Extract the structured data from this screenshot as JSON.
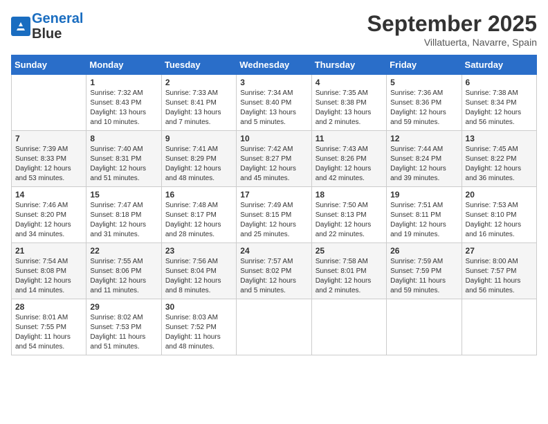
{
  "header": {
    "logo_line1": "General",
    "logo_line2": "Blue",
    "month": "September 2025",
    "location": "Villatuerta, Navarre, Spain"
  },
  "weekdays": [
    "Sunday",
    "Monday",
    "Tuesday",
    "Wednesday",
    "Thursday",
    "Friday",
    "Saturday"
  ],
  "weeks": [
    [
      {
        "day": "",
        "info": ""
      },
      {
        "day": "1",
        "info": "Sunrise: 7:32 AM\nSunset: 8:43 PM\nDaylight: 13 hours\nand 10 minutes."
      },
      {
        "day": "2",
        "info": "Sunrise: 7:33 AM\nSunset: 8:41 PM\nDaylight: 13 hours\nand 7 minutes."
      },
      {
        "day": "3",
        "info": "Sunrise: 7:34 AM\nSunset: 8:40 PM\nDaylight: 13 hours\nand 5 minutes."
      },
      {
        "day": "4",
        "info": "Sunrise: 7:35 AM\nSunset: 8:38 PM\nDaylight: 13 hours\nand 2 minutes."
      },
      {
        "day": "5",
        "info": "Sunrise: 7:36 AM\nSunset: 8:36 PM\nDaylight: 12 hours\nand 59 minutes."
      },
      {
        "day": "6",
        "info": "Sunrise: 7:38 AM\nSunset: 8:34 PM\nDaylight: 12 hours\nand 56 minutes."
      }
    ],
    [
      {
        "day": "7",
        "info": "Sunrise: 7:39 AM\nSunset: 8:33 PM\nDaylight: 12 hours\nand 53 minutes."
      },
      {
        "day": "8",
        "info": "Sunrise: 7:40 AM\nSunset: 8:31 PM\nDaylight: 12 hours\nand 51 minutes."
      },
      {
        "day": "9",
        "info": "Sunrise: 7:41 AM\nSunset: 8:29 PM\nDaylight: 12 hours\nand 48 minutes."
      },
      {
        "day": "10",
        "info": "Sunrise: 7:42 AM\nSunset: 8:27 PM\nDaylight: 12 hours\nand 45 minutes."
      },
      {
        "day": "11",
        "info": "Sunrise: 7:43 AM\nSunset: 8:26 PM\nDaylight: 12 hours\nand 42 minutes."
      },
      {
        "day": "12",
        "info": "Sunrise: 7:44 AM\nSunset: 8:24 PM\nDaylight: 12 hours\nand 39 minutes."
      },
      {
        "day": "13",
        "info": "Sunrise: 7:45 AM\nSunset: 8:22 PM\nDaylight: 12 hours\nand 36 minutes."
      }
    ],
    [
      {
        "day": "14",
        "info": "Sunrise: 7:46 AM\nSunset: 8:20 PM\nDaylight: 12 hours\nand 34 minutes."
      },
      {
        "day": "15",
        "info": "Sunrise: 7:47 AM\nSunset: 8:18 PM\nDaylight: 12 hours\nand 31 minutes."
      },
      {
        "day": "16",
        "info": "Sunrise: 7:48 AM\nSunset: 8:17 PM\nDaylight: 12 hours\nand 28 minutes."
      },
      {
        "day": "17",
        "info": "Sunrise: 7:49 AM\nSunset: 8:15 PM\nDaylight: 12 hours\nand 25 minutes."
      },
      {
        "day": "18",
        "info": "Sunrise: 7:50 AM\nSunset: 8:13 PM\nDaylight: 12 hours\nand 22 minutes."
      },
      {
        "day": "19",
        "info": "Sunrise: 7:51 AM\nSunset: 8:11 PM\nDaylight: 12 hours\nand 19 minutes."
      },
      {
        "day": "20",
        "info": "Sunrise: 7:53 AM\nSunset: 8:10 PM\nDaylight: 12 hours\nand 16 minutes."
      }
    ],
    [
      {
        "day": "21",
        "info": "Sunrise: 7:54 AM\nSunset: 8:08 PM\nDaylight: 12 hours\nand 14 minutes."
      },
      {
        "day": "22",
        "info": "Sunrise: 7:55 AM\nSunset: 8:06 PM\nDaylight: 12 hours\nand 11 minutes."
      },
      {
        "day": "23",
        "info": "Sunrise: 7:56 AM\nSunset: 8:04 PM\nDaylight: 12 hours\nand 8 minutes."
      },
      {
        "day": "24",
        "info": "Sunrise: 7:57 AM\nSunset: 8:02 PM\nDaylight: 12 hours\nand 5 minutes."
      },
      {
        "day": "25",
        "info": "Sunrise: 7:58 AM\nSunset: 8:01 PM\nDaylight: 12 hours\nand 2 minutes."
      },
      {
        "day": "26",
        "info": "Sunrise: 7:59 AM\nSunset: 7:59 PM\nDaylight: 11 hours\nand 59 minutes."
      },
      {
        "day": "27",
        "info": "Sunrise: 8:00 AM\nSunset: 7:57 PM\nDaylight: 11 hours\nand 56 minutes."
      }
    ],
    [
      {
        "day": "28",
        "info": "Sunrise: 8:01 AM\nSunset: 7:55 PM\nDaylight: 11 hours\nand 54 minutes."
      },
      {
        "day": "29",
        "info": "Sunrise: 8:02 AM\nSunset: 7:53 PM\nDaylight: 11 hours\nand 51 minutes."
      },
      {
        "day": "30",
        "info": "Sunrise: 8:03 AM\nSunset: 7:52 PM\nDaylight: 11 hours\nand 48 minutes."
      },
      {
        "day": "",
        "info": ""
      },
      {
        "day": "",
        "info": ""
      },
      {
        "day": "",
        "info": ""
      },
      {
        "day": "",
        "info": ""
      }
    ]
  ]
}
